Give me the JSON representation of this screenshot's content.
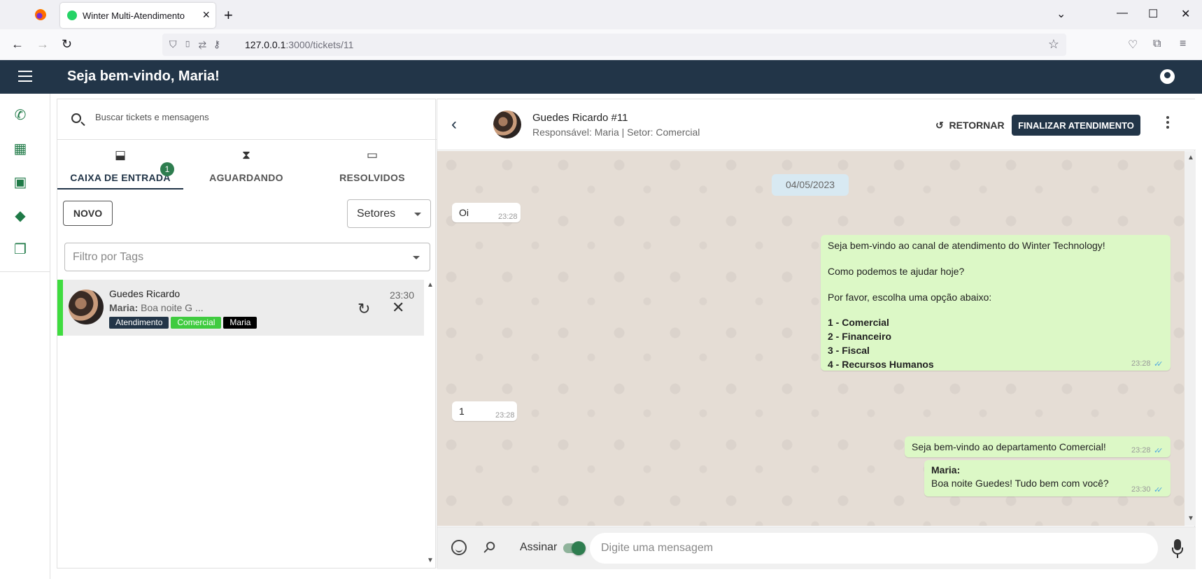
{
  "browser": {
    "tab_title": "Winter Multi-Atendimento",
    "url_host": "127.0.0.1",
    "url_rest": ":3000/tickets/11"
  },
  "app": {
    "welcome": "Seja bem-vindo, Maria!"
  },
  "sidenav": {
    "items": [
      "whatsapp-icon",
      "dashboard-icon",
      "contacts-icon",
      "tags-icon",
      "chats-icon"
    ]
  },
  "tickets": {
    "search_placeholder": "Buscar tickets e mensagens",
    "tabs": [
      {
        "label": "CAIXA DE ENTRADA",
        "icon": "inbox-icon",
        "badge": "1"
      },
      {
        "label": "AGUARDANDO",
        "icon": "hourglass-icon"
      },
      {
        "label": "RESOLVIDOS",
        "icon": "archive-icon"
      }
    ],
    "new_button": "NOVO",
    "sector_select": "Setores",
    "tag_filter_placeholder": "Filtro por Tags",
    "items": [
      {
        "name": "Guedes Ricardo",
        "last_sender": "Maria:",
        "last_message": "Boa noite G ...",
        "time": "23:30",
        "tags": [
          {
            "label": "Atendimento",
            "color": "#223548"
          },
          {
            "label": "Comercial",
            "color": "#3fcb3f"
          },
          {
            "label": "Maria",
            "color": "#000000"
          }
        ],
        "status_color": "#3fdc3f"
      }
    ]
  },
  "chat": {
    "contact_name": "Guedes Ricardo #11",
    "subtitle": "Responsável: Maria | Setor: Comercial",
    "return_button": "RETORNAR",
    "finish_button": "FINALIZAR ATENDIMENTO",
    "date_chip": "04/05/2023",
    "messages": [
      {
        "dir": "in",
        "lines": [
          "Oi"
        ],
        "time": "23:28"
      },
      {
        "dir": "out",
        "lines": [
          "Seja bem-vindo ao canal de atendimento do Winter Technology!",
          "",
          "Como podemos te ajudar hoje?",
          "",
          "Por favor, escolha uma opção abaixo:",
          "",
          "1 - Comercial",
          "2 - Financeiro",
          "3 - Fiscal",
          "4 - Recursos Humanos"
        ],
        "time": "23:28"
      },
      {
        "dir": "in",
        "lines": [
          "1"
        ],
        "time": "23:28"
      },
      {
        "dir": "out",
        "lines": [
          "Seja bem-vindo ao departamento Comercial!"
        ],
        "time": "23:28"
      },
      {
        "dir": "out",
        "lines": [
          "Maria:",
          "Boa noite Guedes! Tudo bem com você?"
        ],
        "time": "23:30"
      }
    ],
    "sign_label": "Assinar",
    "sign_enabled": true,
    "input_placeholder": "Digite uma mensagem"
  },
  "colors": {
    "primary": "#223548",
    "accent_green": "#2e7d4f",
    "outgoing_bubble": "#dcf8c6",
    "chat_bg": "#e5ddd5"
  }
}
